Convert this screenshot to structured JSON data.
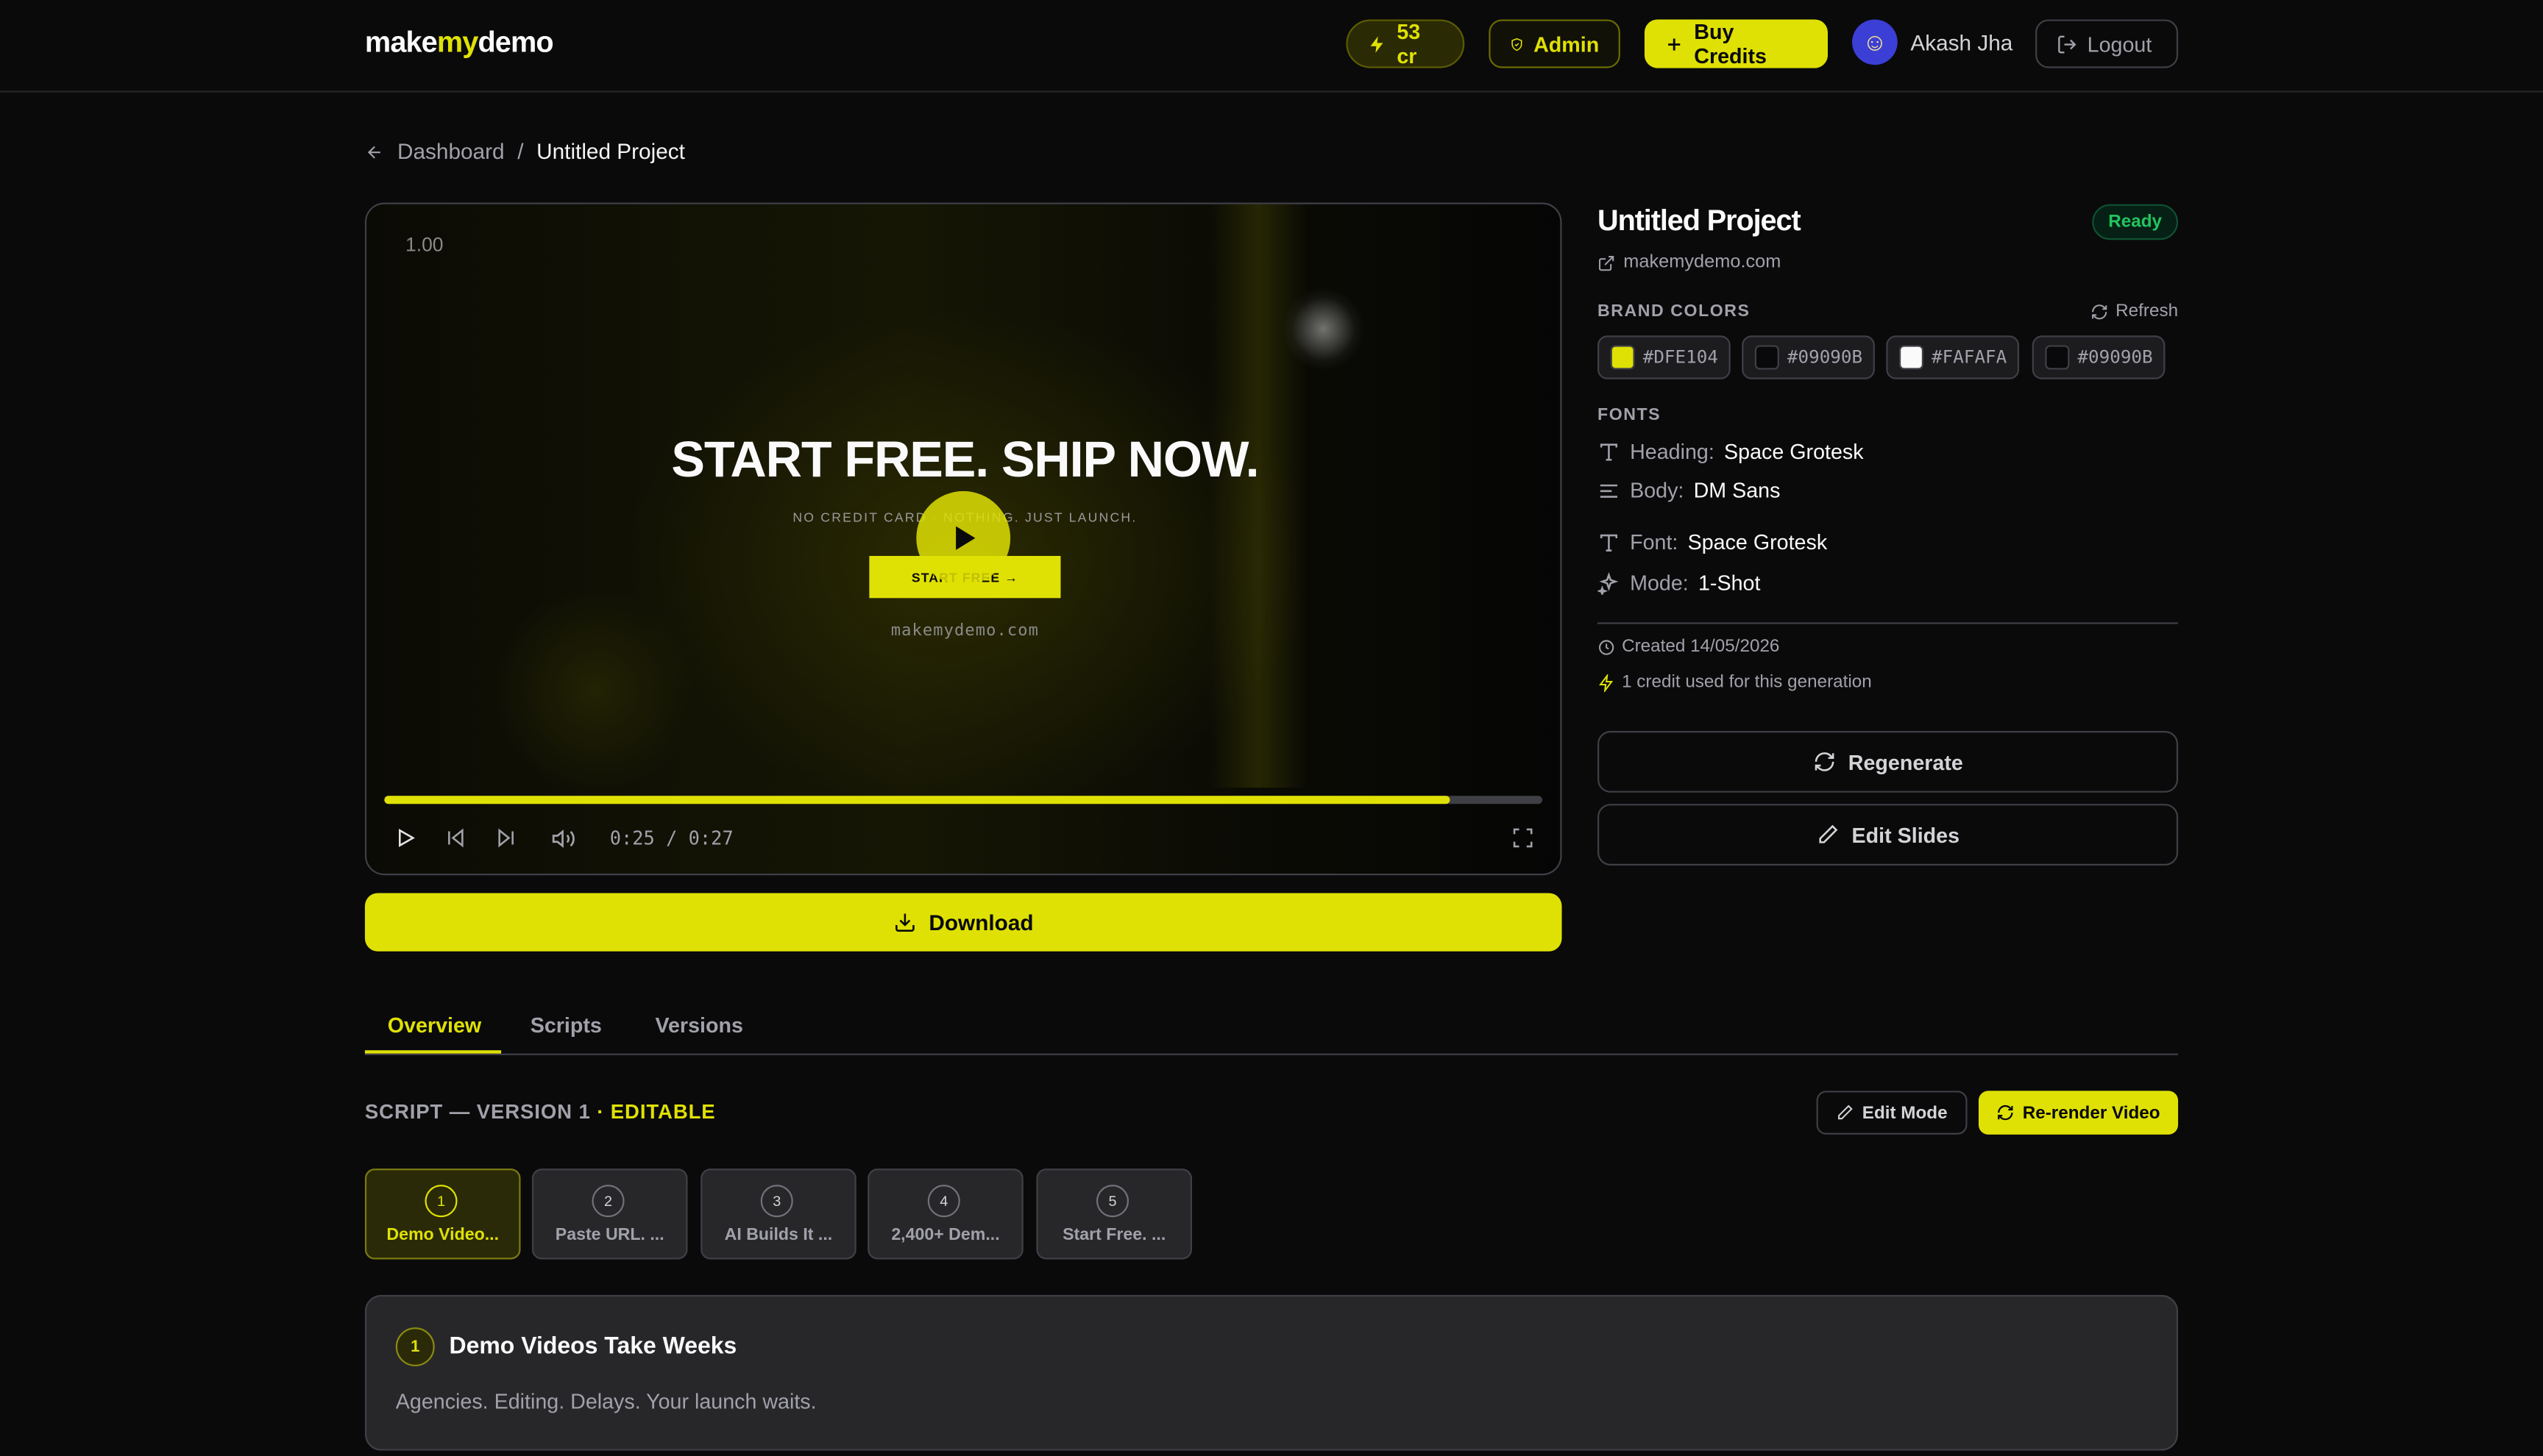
{
  "header": {
    "logo_pre": "make",
    "logo_mid": "my",
    "logo_post": "demo",
    "credits": "53 cr",
    "admin": "Admin",
    "buy_credits": "Buy Credits",
    "user_name": "Akash Jha",
    "logout": "Logout"
  },
  "breadcrumb": {
    "parent": "Dashboard",
    "separator": "/",
    "current": "Untitled Project"
  },
  "player": {
    "speed": "1.00",
    "headline": "START FREE. SHIP NOW.",
    "subline": "NO CREDIT CARD · NOTHING. JUST LAUNCH.",
    "cta": "START FREE →",
    "url": "makemydemo.com",
    "current_time": "0:25",
    "time_sep": "/",
    "duration": "0:27",
    "progress": 0.92
  },
  "download": "Download",
  "project": {
    "title": "Untitled Project",
    "status": "Ready",
    "url": "makemydemo.com",
    "brand_colors_label": "BRAND COLORS",
    "refresh": "Refresh",
    "colors": [
      "#DFE104",
      "#09090B",
      "#FAFAFA",
      "#09090B"
    ],
    "fonts_label": "FONTS",
    "heading_label": "Heading:",
    "heading_font": "Space Grotesk",
    "body_label": "Body:",
    "body_font": "DM Sans",
    "font_label": "Font:",
    "font_value": "Space Grotesk",
    "mode_label": "Mode:",
    "mode_value": "1-Shot",
    "created": "Created 14/05/2026",
    "credit_note": "1 credit used for this generation",
    "regenerate": "Regenerate",
    "edit_slides": "Edit Slides"
  },
  "tabs": [
    "Overview",
    "Scripts",
    "Versions"
  ],
  "script": {
    "label": "SCRIPT — VERSION 1",
    "editable": "· EDITABLE",
    "edit_mode": "Edit Mode",
    "rerender": "Re-render Video",
    "scenes": [
      {
        "num": "1",
        "label": "Demo Video..."
      },
      {
        "num": "2",
        "label": "Paste URL. ..."
      },
      {
        "num": "3",
        "label": "AI Builds It ..."
      },
      {
        "num": "4",
        "label": "2,400+ Dem..."
      },
      {
        "num": "5",
        "label": "Start Free. ..."
      }
    ],
    "card": {
      "num": "1",
      "title": "Demo Videos Take Weeks",
      "body": "Agencies. Editing. Delays. Your launch waits."
    }
  },
  "colors": {
    "accent": "#DFE104",
    "background": "#0A0A0B",
    "ready_green": "#22C55E"
  }
}
